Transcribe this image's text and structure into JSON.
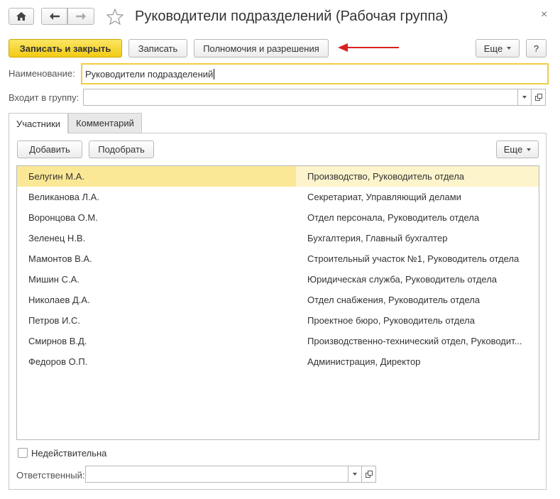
{
  "window": {
    "title": "Руководители подразделений (Рабочая группа)",
    "close_glyph": "×"
  },
  "toolbar": {
    "save_close_label": "Записать и закрыть",
    "save_label": "Записать",
    "permissions_label": "Полномочия и разрешения",
    "more_label": "Еще",
    "help_label": "?"
  },
  "fields": {
    "name_label": "Наименование:",
    "name_value": "Руководители подразделений",
    "group_label": "Входит в группу:",
    "group_value": "",
    "responsible_label": "Ответственный:",
    "responsible_value": ""
  },
  "tabs": [
    {
      "label": "Участники",
      "active": true
    },
    {
      "label": "Комментарий",
      "active": false
    }
  ],
  "members_toolbar": {
    "add_label": "Добавить",
    "pick_label": "Подобрать",
    "more_label": "Еще"
  },
  "members": [
    {
      "name": "Белугин М.А.",
      "position": "Производство, Руководитель отдела"
    },
    {
      "name": "Великанова Л.А.",
      "position": "Секретариат, Управляющий делами"
    },
    {
      "name": "Воронцова О.М.",
      "position": "Отдел персонала, Руководитель отдела"
    },
    {
      "name": "Зеленец Н.В.",
      "position": "Бухгалтерия, Главный бухгалтер"
    },
    {
      "name": "Мамонтов В.А.",
      "position": "Строительный участок №1, Руководитель отдела"
    },
    {
      "name": "Мишин С.А.",
      "position": "Юридическая служба, Руководитель отдела"
    },
    {
      "name": "Николаев Д.А.",
      "position": "Отдел снабжения, Руководитель отдела"
    },
    {
      "name": "Петров И.С.",
      "position": "Проектное бюро, Руководитель отдела"
    },
    {
      "name": "Смирнов В.Д.",
      "position": "Производственно-технический отдел, Руководит..."
    },
    {
      "name": "Федоров О.П.",
      "position": "Администрация, Директор"
    }
  ],
  "invalid_checkbox_label": "Недействительна",
  "colors": {
    "primary_button": "#f2cb13",
    "selected_row": "#fbe896",
    "focus_border": "#f2cd3f",
    "annotation_arrow": "#d9201f"
  },
  "icons": [
    "home-icon",
    "back-arrow-icon",
    "forward-arrow-icon",
    "star-icon",
    "close-icon",
    "dropdown-arrow-icon",
    "open-icon"
  ]
}
